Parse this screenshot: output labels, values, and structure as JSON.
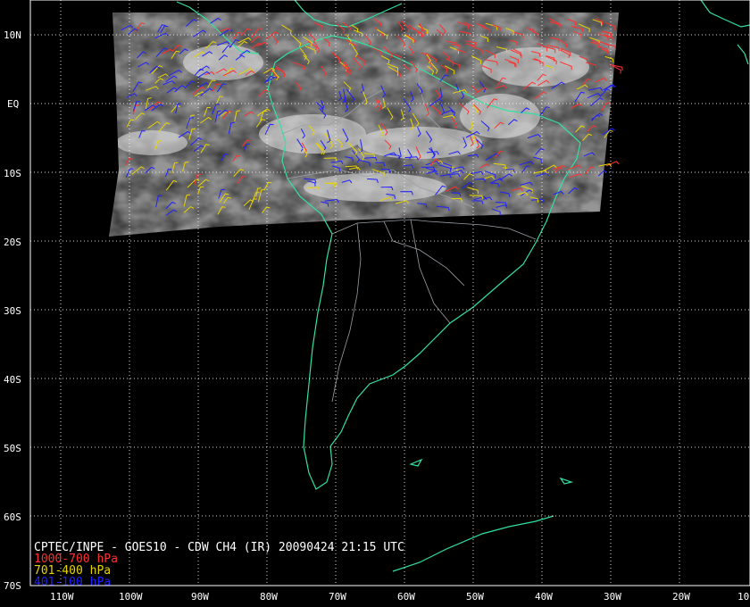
{
  "map": {
    "lat_labels": [
      "10N",
      "EQ",
      "10S",
      "20S",
      "30S",
      "40S",
      "50S",
      "60S",
      "70S"
    ],
    "lon_labels": [
      "110W",
      "100W",
      "90W",
      "80W",
      "70W",
      "60W",
      "50W",
      "40W",
      "30W",
      "20W",
      "10"
    ],
    "caption": {
      "title": "CPTEC/INPE - GOES10 - CDW CH4 (IR) 20090424 21:15 UTC",
      "legend": [
        {
          "label": "1000-700 hPa",
          "color": "#ff3030"
        },
        {
          "label": "701-400 hPa",
          "color": "#e8d400"
        },
        {
          "label": "401-100 hPa",
          "color": "#2020ff"
        }
      ]
    },
    "colors": {
      "background": "#000000",
      "coastline": "#33e0a0",
      "grid": "#ffffff",
      "satellite_cloud": "#8c8c8c"
    }
  }
}
